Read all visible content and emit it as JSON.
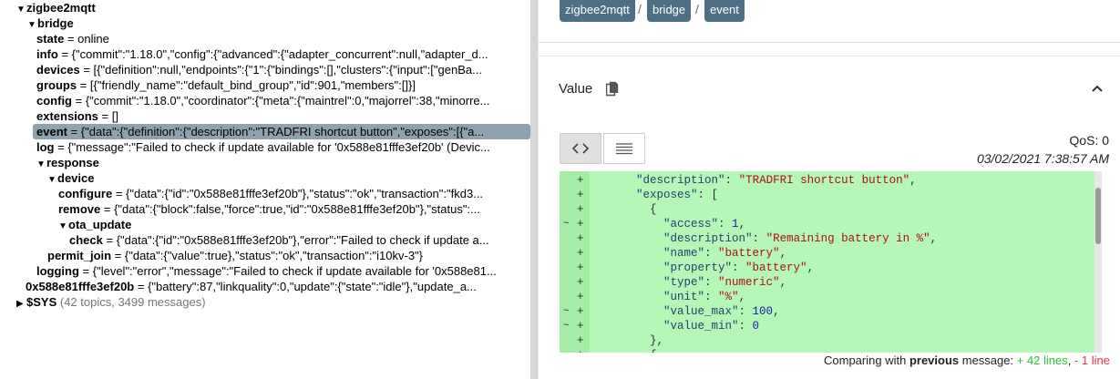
{
  "tree": {
    "root": "zigbee2mqtt",
    "bridge": "bridge",
    "state_k": "state",
    "state_v": " = online",
    "info_k": "info",
    "info_v": " = {\"commit\":\"1.18.0\",\"config\":{\"advanced\":{\"adapter_concurrent\":null,\"adapter_d...",
    "devices_k": "devices",
    "devices_v": " = [{\"definition\":null,\"endpoints\":{\"1\":{\"bindings\":[],\"clusters\":{\"input\":[\"genBa...",
    "groups_k": "groups",
    "groups_v": " = [{\"friendly_name\":\"default_bind_group\",\"id\":901,\"members\":[]}]",
    "config_k": "config",
    "config_v": " = {\"commit\":\"1.18.0\",\"coordinator\":{\"meta\":{\"maintrel\":0,\"majorrel\":38,\"minorre...",
    "extensions_k": "extensions",
    "extensions_v": " = []",
    "event_k": "event",
    "event_v": " = {\"data\":{\"definition\":{\"description\":\"TRADFRI shortcut button\",\"exposes\":[{\"a...",
    "log_k": "log",
    "log_v": " = {\"message\":\"Failed to check if update available for '0x588e81fffe3ef20b' (Devic...",
    "response": "response",
    "device": "device",
    "configure_k": "configure",
    "configure_v": " = {\"data\":{\"id\":\"0x588e81fffe3ef20b\"},\"status\":\"ok\",\"transaction\":\"fkd3...",
    "remove_k": "remove",
    "remove_v": " = {\"data\":{\"block\":false,\"force\":true,\"id\":\"0x588e81fffe3ef20b\"},\"status\":...",
    "ota_update": "ota_update",
    "check_k": "check",
    "check_v": " = {\"data\":{\"id\":\"0x588e81fffe3ef20b\"},\"error\":\"Failed to check if update a...",
    "permit_join_k": "permit_join",
    "permit_join_v": " = {\"data\":{\"value\":true},\"status\":\"ok\",\"transaction\":\"i10kv-3\"}",
    "logging_k": "logging",
    "logging_v": " = {\"level\":\"error\",\"message\":\"Failed to check if update available for '0x588e81...",
    "device_node_k": "0x588e81fffe3ef20b",
    "device_node_v": " = {\"battery\":87,\"linkquality\":0,\"update\":{\"state\":\"idle\"},\"update_a...",
    "sys_k": "$SYS",
    "sys_count": " (42 topics, 3499 messages)"
  },
  "breadcrumb": [
    "zigbee2mqtt",
    "bridge",
    "event"
  ],
  "breadcrumb_sep": "/",
  "value_title": "Value",
  "qos": "QoS: 0",
  "timestamp": "03/02/2021 7:38:57 AM",
  "diff_lines": [
    {
      "mark": "",
      "plus": "+",
      "parts": [
        [
          "p",
          "    "
        ],
        [
          "k",
          "\"description\""
        ],
        [
          "p",
          ": "
        ],
        [
          "s",
          "\"TRADFRI shortcut button\""
        ],
        [
          "p",
          ","
        ]
      ]
    },
    {
      "mark": "",
      "plus": "+",
      "parts": [
        [
          "p",
          "    "
        ],
        [
          "k",
          "\"exposes\""
        ],
        [
          "p",
          ": ["
        ]
      ]
    },
    {
      "mark": "",
      "plus": "+",
      "parts": [
        [
          "p",
          "      {"
        ]
      ]
    },
    {
      "mark": "~",
      "plus": "+",
      "parts": [
        [
          "p",
          "        "
        ],
        [
          "k",
          "\"access\""
        ],
        [
          "p",
          ": "
        ],
        [
          "n",
          "1"
        ],
        [
          "p",
          ","
        ]
      ]
    },
    {
      "mark": "",
      "plus": "+",
      "parts": [
        [
          "p",
          "        "
        ],
        [
          "k",
          "\"description\""
        ],
        [
          "p",
          ": "
        ],
        [
          "s",
          "\"Remaining battery in %\""
        ],
        [
          "p",
          ","
        ]
      ]
    },
    {
      "mark": "",
      "plus": "+",
      "parts": [
        [
          "p",
          "        "
        ],
        [
          "k",
          "\"name\""
        ],
        [
          "p",
          ": "
        ],
        [
          "s",
          "\"battery\""
        ],
        [
          "p",
          ","
        ]
      ]
    },
    {
      "mark": "",
      "plus": "+",
      "parts": [
        [
          "p",
          "        "
        ],
        [
          "k",
          "\"property\""
        ],
        [
          "p",
          ": "
        ],
        [
          "s",
          "\"battery\""
        ],
        [
          "p",
          ","
        ]
      ]
    },
    {
      "mark": "",
      "plus": "+",
      "parts": [
        [
          "p",
          "        "
        ],
        [
          "k",
          "\"type\""
        ],
        [
          "p",
          ": "
        ],
        [
          "s",
          "\"numeric\""
        ],
        [
          "p",
          ","
        ]
      ]
    },
    {
      "mark": "",
      "plus": "+",
      "parts": [
        [
          "p",
          "        "
        ],
        [
          "k",
          "\"unit\""
        ],
        [
          "p",
          ": "
        ],
        [
          "s",
          "\"%\""
        ],
        [
          "p",
          ","
        ]
      ]
    },
    {
      "mark": "~",
      "plus": "+",
      "parts": [
        [
          "p",
          "        "
        ],
        [
          "k",
          "\"value_max\""
        ],
        [
          "p",
          ": "
        ],
        [
          "n",
          "100"
        ],
        [
          "p",
          ","
        ]
      ]
    },
    {
      "mark": "~",
      "plus": "+",
      "parts": [
        [
          "p",
          "        "
        ],
        [
          "k",
          "\"value_min\""
        ],
        [
          "p",
          ": "
        ],
        [
          "n",
          "0"
        ]
      ]
    },
    {
      "mark": "",
      "plus": "+",
      "parts": [
        [
          "p",
          "      },"
        ]
      ]
    },
    {
      "mark": "",
      "plus": "+",
      "parts": [
        [
          "p",
          "      {"
        ]
      ]
    }
  ],
  "compare": {
    "prefix": "Comparing with ",
    "bold": "previous",
    "middle": " message: ",
    "added": "+ 42 lines",
    "sep": ", ",
    "removed": "- 1 line"
  },
  "colors": {
    "crumb": "#4e7086",
    "diff_bg": "#b6f6b6",
    "added": "#2fbf3f",
    "removed": "#e03b3b"
  }
}
